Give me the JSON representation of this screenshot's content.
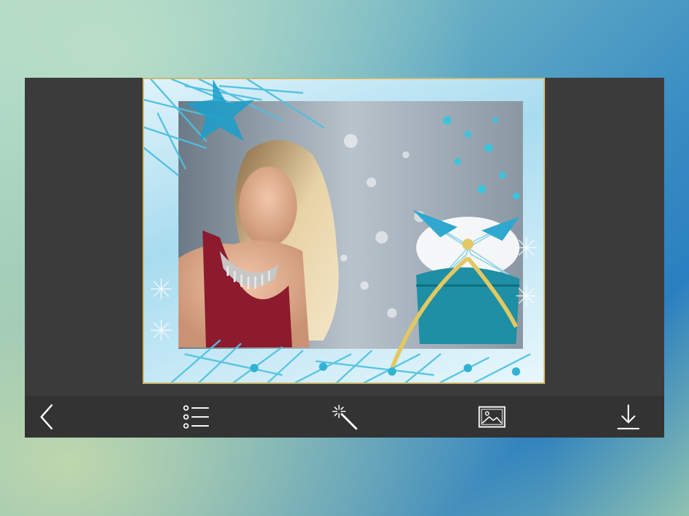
{
  "toolbar": {
    "buttons": [
      {
        "name": "back",
        "icon": "chevron-left-icon"
      },
      {
        "name": "frames-list",
        "icon": "list-icon"
      },
      {
        "name": "effects",
        "icon": "magic-wand-icon"
      },
      {
        "name": "gallery",
        "icon": "image-icon"
      },
      {
        "name": "download",
        "icon": "download-icon"
      }
    ]
  },
  "colors": {
    "panel": "#3a3a3a",
    "toolbar": "#333333",
    "icon": "#ffffff",
    "frame_accent": "#2fb3d4",
    "frame_gold": "#cdb66a"
  }
}
